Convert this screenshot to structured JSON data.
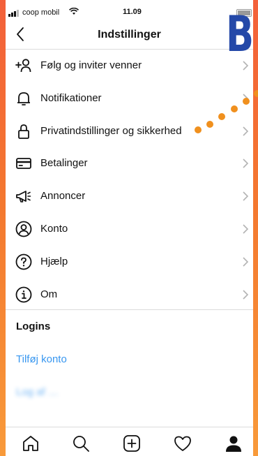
{
  "status_bar": {
    "carrier": "coop mobil",
    "time": "11.09",
    "battery_level": 0.9
  },
  "header": {
    "title": "Indstillinger",
    "back_icon": "chevron-left-icon"
  },
  "menu": {
    "items": [
      {
        "label": "Følg og inviter venner",
        "icon": "add-person-icon"
      },
      {
        "label": "Notifikationer",
        "icon": "bell-icon"
      },
      {
        "label": "Privatindstillinger og sikkerhed",
        "icon": "lock-icon"
      },
      {
        "label": "Betalinger",
        "icon": "credit-card-icon"
      },
      {
        "label": "Annoncer",
        "icon": "megaphone-icon"
      },
      {
        "label": "Konto",
        "icon": "account-icon"
      },
      {
        "label": "Hjælp",
        "icon": "help-icon"
      },
      {
        "label": "Om",
        "icon": "info-icon"
      }
    ]
  },
  "logins": {
    "section_title": "Logins",
    "add_account": "Tilføj konto",
    "logout": "Log af …"
  },
  "tabs": [
    "home-icon",
    "search-icon",
    "add-post-icon",
    "heart-icon",
    "profile-icon"
  ],
  "overlay": {
    "letter": "B",
    "letter_color": "#2448a8",
    "dot_color": "#f0901e"
  },
  "colors": {
    "link": "#3897f0",
    "background_gradient_top": "#f3603a",
    "background_gradient_bottom": "#f89a3a"
  }
}
